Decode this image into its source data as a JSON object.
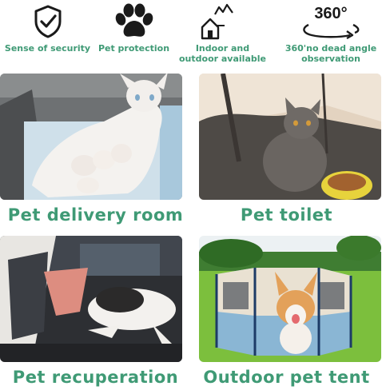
{
  "features": [
    {
      "label": "Sense of security",
      "icon": "shield-check-icon"
    },
    {
      "label": "Pet protection",
      "icon": "paw-icon"
    },
    {
      "label": "Indoor and outdoor available",
      "icon": "house-mountain-icon"
    },
    {
      "label": "360'no dead angle observation",
      "icon": "rotate-360-icon",
      "icon_text": "360°"
    }
  ],
  "panels": [
    {
      "caption": "Pet delivery room"
    },
    {
      "caption": "Pet toilet"
    },
    {
      "caption": "Pet recuperation"
    },
    {
      "caption": "Outdoor pet tent"
    }
  ],
  "colors": {
    "accent": "#3f9a75",
    "icon": "#1a1a1a"
  }
}
